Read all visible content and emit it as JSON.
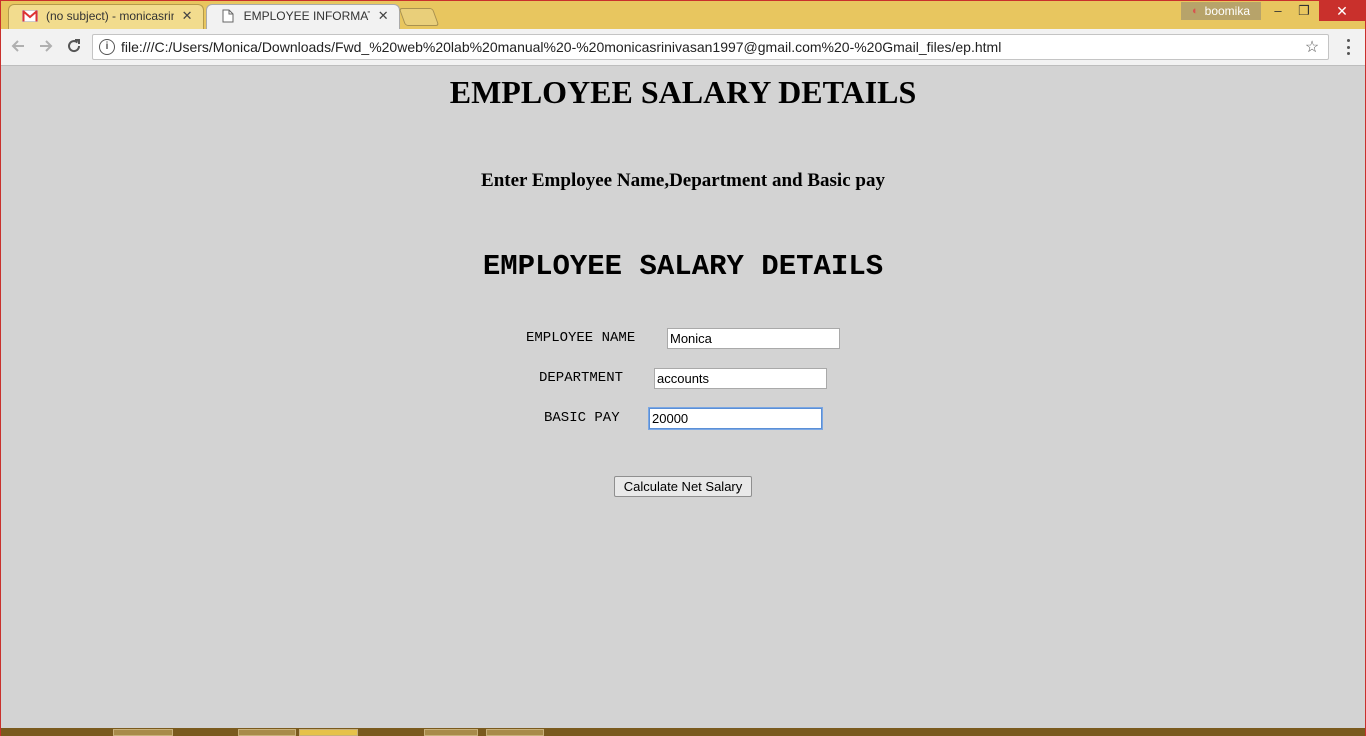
{
  "browser": {
    "tabs": [
      {
        "title": "(no subject) - monicasrin",
        "icon": "gmail-icon",
        "active": false
      },
      {
        "title": "EMPLOYEE INFORMATIC",
        "icon": "page-icon",
        "active": true
      }
    ],
    "user_badge": "boomika",
    "url": "file:///C:/Users/Monica/Downloads/Fwd_%20web%20lab%20manual%20-%20monicasrinivasan1997@gmail.com%20-%20Gmail_files/ep.html",
    "tab_close_symbol": "✕",
    "window_buttons": {
      "minimize": "–",
      "restore": "❐",
      "close": "✕"
    }
  },
  "page": {
    "main_heading": "EMPLOYEE SALARY DETAILS",
    "instruction": "Enter Employee Name,Department and Basic pay",
    "form_heading": "EMPLOYEE SALARY DETAILS",
    "fields": {
      "name_label": "EMPLOYEE NAME",
      "name_value": "Monica",
      "department_label": "DEPARTMENT",
      "department_value": "accounts",
      "basic_pay_label": "BASIC PAY",
      "basic_pay_value": "20000"
    },
    "submit_label": "Calculate Net Salary"
  },
  "colors": {
    "page_background": "#d3d3d3",
    "tabstrip": "#e8c65f",
    "close_button": "#c9302c"
  }
}
